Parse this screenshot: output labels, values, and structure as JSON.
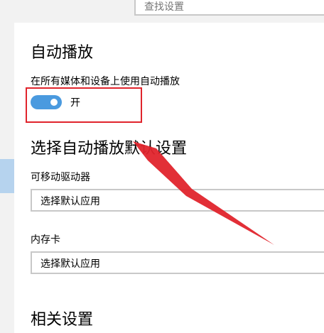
{
  "search": {
    "placeholder": "查找设置"
  },
  "section_autoplay": {
    "title": "自动播放",
    "toggle_label": "在所有媒体和设备上使用自动播放",
    "toggle_state_text": "开",
    "toggle_on": true
  },
  "section_defaults": {
    "title": "选择自动播放默认设置",
    "removable_drive": {
      "label": "可移动驱动器",
      "value": "选择默认应用"
    },
    "memory_card": {
      "label": "内存卡",
      "value": "选择默认应用"
    }
  },
  "section_related": {
    "title": "相关设置"
  },
  "colors": {
    "accent": "#4a9adf",
    "annotation": "#e0242c",
    "rail_selected": "#b6d3ee"
  }
}
